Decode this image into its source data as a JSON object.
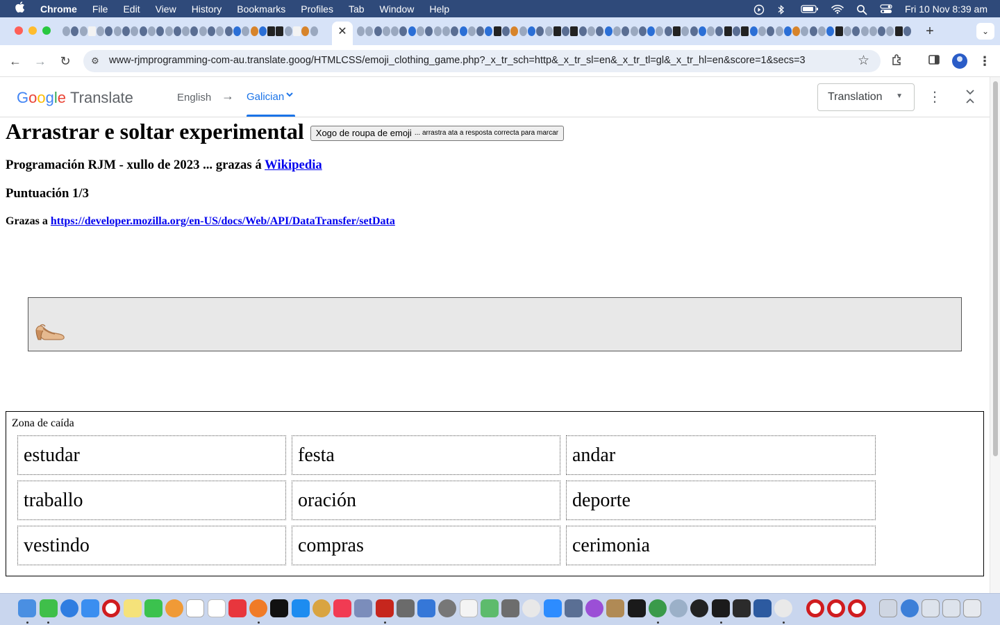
{
  "menubar": {
    "app": "Chrome",
    "items": [
      "File",
      "Edit",
      "View",
      "History",
      "Bookmarks",
      "Profiles",
      "Tab",
      "Window",
      "Help"
    ],
    "clock": "Fri 10 Nov  8:39 am"
  },
  "browser": {
    "url": "www-rjmprogramming-com-au.translate.goog/HTMLCSS/emoji_clothing_game.php?_x_tr_sch=http&_x_tr_sl=en&_x_tr_tl=gl&_x_tr_hl=en&score=1&secs=3",
    "new_tab": "+"
  },
  "translate": {
    "logo": [
      "G",
      "o",
      "o",
      "g",
      "l",
      "e"
    ],
    "logo_suffix": "Translate",
    "source": "English",
    "arrow": "→",
    "target": "Galician",
    "mode": "Translation"
  },
  "page": {
    "title": "Arrastrar e soltar experimental",
    "game_button": "Xogo de roupa de emoji",
    "game_button_hint": "... arrastra ata a resposta correcta para marcar",
    "credit_prefix": "Programación RJM - xullo de 2023 ... grazas á ",
    "credit_link": "Wikipedia",
    "score": "Puntuación 1/3",
    "thanks_prefix": "Grazas a ",
    "thanks_link": "https://developer.mozilla.org/en-US/docs/Web/API/DataTransfer/setData",
    "drag_item": "high-heel-sandal",
    "dropzone_label": "Zona de caída",
    "answers": [
      [
        "estudar",
        "festa",
        "andar"
      ],
      [
        "traballo",
        "oración",
        "deporte"
      ],
      [
        "vestindo",
        "compras",
        "cerimonia"
      ]
    ]
  },
  "colors": {
    "menubar": "#2f4a7a",
    "tabstrip": "#d7e3f8",
    "link": "#0000ee",
    "translate_accent": "#1a73e8",
    "emoji_box": "#e8e8e8"
  }
}
